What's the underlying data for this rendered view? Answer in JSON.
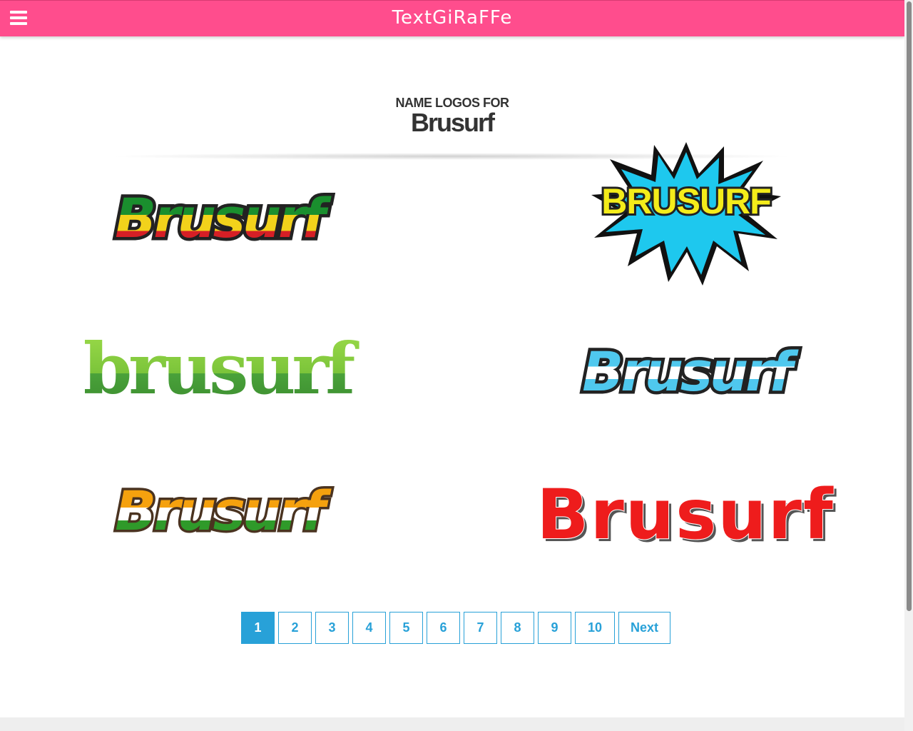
{
  "header": {
    "brand": "TextGiRaFFe",
    "menu_icon": "hamburger-icon",
    "color": "#ff4d8d"
  },
  "page": {
    "subheading": "NAME LOGOS FOR",
    "name": "Brusurf"
  },
  "logos": [
    {
      "text": "Brusurf",
      "style": "rasta-script"
    },
    {
      "text": "BRUSURF",
      "style": "comic-burst"
    },
    {
      "text": "brusurf",
      "style": "green-bold"
    },
    {
      "text": "Brusurf",
      "style": "blue-script"
    },
    {
      "text": "Brusurf",
      "style": "tricolor-script"
    },
    {
      "text": "Brusurf",
      "style": "red-brush"
    }
  ],
  "pagination": {
    "pages": [
      "1",
      "2",
      "3",
      "4",
      "5",
      "6",
      "7",
      "8",
      "9",
      "10"
    ],
    "active": "1",
    "next_label": "Next",
    "accent": "#28a1d8"
  }
}
